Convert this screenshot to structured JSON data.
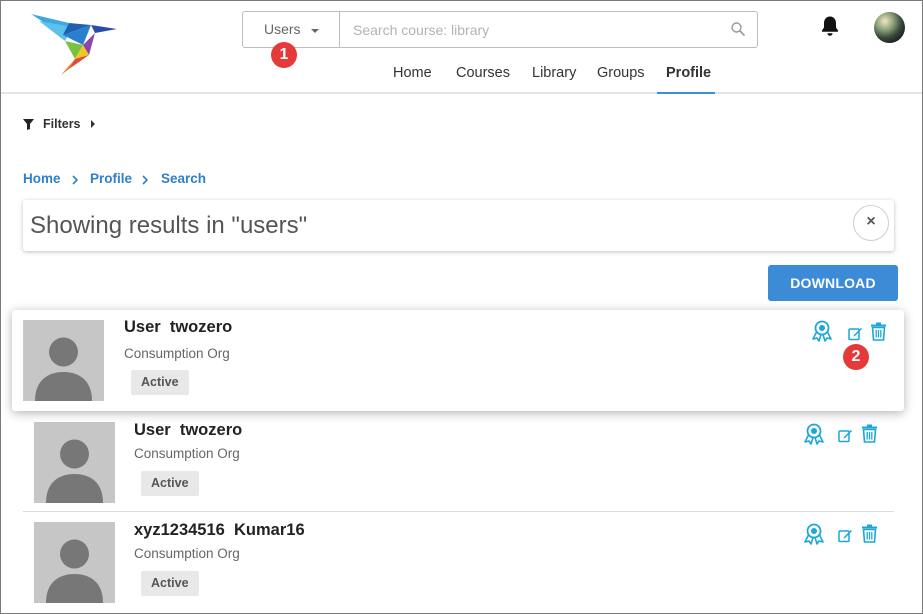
{
  "header": {
    "search_type": "Users",
    "search_placeholder": "Search course: library",
    "search_value": "",
    "nav": [
      {
        "label": "Home",
        "active": false
      },
      {
        "label": "Courses",
        "active": false
      },
      {
        "label": "Library",
        "active": false
      },
      {
        "label": "Groups",
        "active": false
      },
      {
        "label": "Profile",
        "active": true
      }
    ],
    "icons": {
      "logo": "hummingbird-logo",
      "search": "search-icon",
      "notifications": "bell-icon",
      "avatar": "user-avatar"
    }
  },
  "annotations": [
    {
      "label": "1",
      "color": "#e6393a"
    },
    {
      "label": "2",
      "color": "#e6393a"
    }
  ],
  "filters": {
    "label": "Filters"
  },
  "breadcrumb": [
    "Home",
    "Profile",
    "Search"
  ],
  "results": {
    "title": "Showing results in \"users\"",
    "clear_icon": "×"
  },
  "download_label": "DOWNLOAD",
  "accent_color": "#3b8bd6",
  "icon_color": "#1ba7d8",
  "users": [
    {
      "name": "User  twozero",
      "org": "Consumption Org",
      "status": "Active",
      "highlighted": true
    },
    {
      "name": "User  twozero",
      "org": "Consumption Org",
      "status": "Active",
      "highlighted": false
    },
    {
      "name": "xyz1234516  Kumar16",
      "org": "Consumption Org",
      "status": "Active",
      "highlighted": false
    }
  ]
}
